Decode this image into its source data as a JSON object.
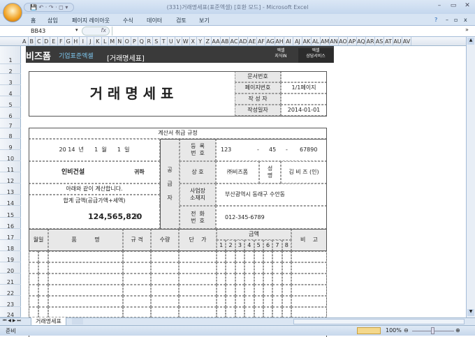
{
  "window": {
    "title": "(331)거래명세표(표준엑셀) [호환 모드] - Microsoft Excel",
    "minimize": "–",
    "restore": "▭",
    "close": "✕"
  },
  "qat": {
    "label": "💾 ↶ · ↷ · ◻ ▾"
  },
  "ribbon": {
    "tabs": [
      "홈",
      "삽입",
      "페이지 레이아웃",
      "수식",
      "데이터",
      "검토",
      "보기"
    ],
    "help": "?",
    "wmin": "–",
    "wrestore": "▫",
    "wclose": "x"
  },
  "formula_bar": {
    "name_box": "BB43",
    "fx": "fx",
    "value": ""
  },
  "columns": [
    "A",
    "B",
    "C",
    "D",
    "E",
    "F",
    "G",
    "H",
    "I",
    "J",
    "K",
    "L",
    "M",
    "N",
    "O",
    "P",
    "Q",
    "R",
    "S",
    "T",
    "U",
    "V",
    "W",
    "X",
    "Y",
    "Z",
    "AA",
    "AB",
    "AC",
    "AD",
    "AE",
    "AF",
    "AG",
    "AH",
    "AI",
    "AJ",
    "AK",
    "AL",
    "AM",
    "AN",
    "AO",
    "AP",
    "AQ",
    "AR",
    "AS",
    "AT",
    "AU",
    "AV"
  ],
  "rows": [
    "1",
    "2",
    "3",
    "4",
    "5",
    "6",
    "7",
    "8",
    "9",
    "10",
    "11",
    "12",
    "13",
    "14",
    "15",
    "16",
    "17",
    "18",
    "19",
    "20",
    "21",
    "22",
    "23",
    "24"
  ],
  "banner": {
    "logo": "비즈폼",
    "subtitle": "기업표준엑셀",
    "doc": "[거래명세표]",
    "btn1_a": "엑셀",
    "btn1_b": "지식IN",
    "btn2_a": "엑셀",
    "btn2_b": "상담서비스"
  },
  "header": {
    "title": "거 래 명 세 표",
    "fields": [
      {
        "label": "문서번호",
        "value": ""
      },
      {
        "label": "페이지번호",
        "value": "1/1페이지"
      },
      {
        "label": "작 성 자",
        "value": ""
      },
      {
        "label": "작성일자",
        "value": "2014-01-01"
      }
    ]
  },
  "invoice": {
    "rule": "계산서 취급 규정",
    "date": "20 14  년      1  월      1  일",
    "customer": "인비건설",
    "honorific": "귀하",
    "note": "아래와 같이 계산합니다.",
    "total_label": "합계 금액(공급가액+세액)",
    "total": "124,565,820",
    "won": "원",
    "supplier_label": "공\n\n급\n\n자",
    "reg_label": "등  록\n번  호",
    "reg": [
      "123",
      "-",
      "45",
      "-",
      "67890"
    ],
    "company_label": "상  호",
    "company": "㈜비즈폼",
    "name_label": "성\n명",
    "name": "김 비 즈  (인)",
    "addr_label": "사업장\n소재지",
    "addr": "부산광역시 동래구 수안동",
    "tel_label": "전  화\n번  호",
    "tel": "012-345-6789"
  },
  "items": {
    "headers": {
      "date": "월일",
      "item": "품          명",
      "spec": "규  격",
      "qty": "수량",
      "price": "단    가",
      "amount": "금액",
      "digits": [
        "1",
        "2",
        "3",
        "4",
        "5",
        "6",
        "7",
        "8"
      ],
      "remark": "비    고"
    }
  },
  "sheet_tabs": {
    "active": "거래명세표"
  },
  "status": {
    "text": "준비",
    "zoom": "100%"
  }
}
